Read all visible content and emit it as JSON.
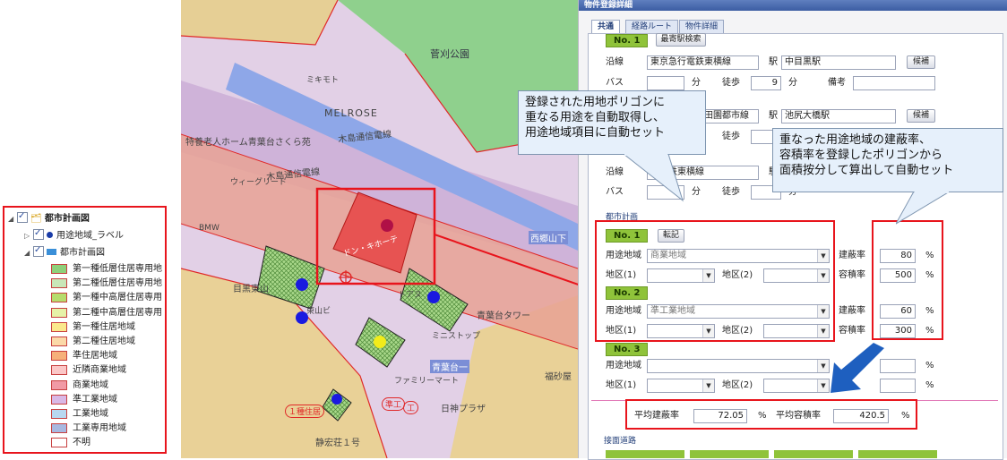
{
  "legend": {
    "root_label": "都市計画図",
    "group_label_layer": "用途地域_ラベル",
    "group_plan": "都市計画図",
    "items": [
      {
        "label": "第一種低層住居専用地",
        "fill": "#8ed07a"
      },
      {
        "label": "第二種低層住居専用地",
        "fill": "#c9e6b8"
      },
      {
        "label": "第一種中高層住居専用",
        "fill": "#b6dc6c"
      },
      {
        "label": "第二種中高層住居専用",
        "fill": "#e6f2a8"
      },
      {
        "label": "第一種住居地域",
        "fill": "#fbe88c"
      },
      {
        "label": "第二種住居地域",
        "fill": "#fbd9a8"
      },
      {
        "label": "準住居地域",
        "fill": "#f6b07a"
      },
      {
        "label": "近隣商業地域",
        "fill": "#fbc7c7"
      },
      {
        "label": "商業地域",
        "fill": "#f19aa5"
      },
      {
        "label": "準工業地域",
        "fill": "#d9b8e6"
      },
      {
        "label": "工業地域",
        "fill": "#b8d8f0"
      },
      {
        "label": "工業専用地域",
        "fill": "#a8b8e0"
      },
      {
        "label": "不明",
        "fill": "#ffffff"
      }
    ]
  },
  "map": {
    "park": "菅刈公園",
    "mikisato": "ミキモト",
    "melrose": "MELROSE",
    "road1": "木島通信電線",
    "road2": "木島通信電線",
    "nursing": "特養老人ホーム青葉台さくら苑",
    "villa": "ウィーグリード",
    "donki": "ドン・キホーテ",
    "station_west": "西郷山下",
    "bmw": "BMW",
    "higashiyama": "目黒東山",
    "higashiyama2": "東山ビ",
    "tora": "トアヌ",
    "ministop": "ミニストップ",
    "aobadai_tower": "青葉台タワー",
    "aobadai": "青葉台一",
    "family": "ファミリーマート",
    "nisshin": "日神プラザ",
    "shigesho": "静宏荘１号",
    "hikawa": "福砂屋",
    "zone_label1": "１種住居",
    "zone_label2": "準工",
    "zone_label3": "工"
  },
  "panel": {
    "title": "物件登録詳細",
    "tabs": [
      "共通",
      "経路ルート",
      "物件詳細"
    ],
    "access_header": "最寄駅検索",
    "no1": "No. 1",
    "no2": "No. 2",
    "no3": "No. 3",
    "line_label": "沿線",
    "station_label": "駅",
    "bus_label": "バス",
    "min_label": "分",
    "walk_label": "徒歩",
    "note_label": "備考",
    "candidate_btn": "候補",
    "lines": [
      {
        "line": "東京急行電鉄東横線",
        "station": "中目黒駅",
        "walk": "9"
      },
      {
        "line": "田園都市線",
        "station": "池尻大橋駅",
        "walk": ""
      },
      {
        "line": "行電鉄東横線",
        "station": "",
        "walk": ""
      }
    ],
    "city_plan_header": "都市計画",
    "transfer_btn": "転記",
    "use_zone_label": "用途地域",
    "district1_label": "地区(1)",
    "district2_label": "地区(2)",
    "bcr_label": "建蔽率",
    "far_label": "容積率",
    "pct": "%",
    "zone1": {
      "use": "商業地域",
      "bcr": "80",
      "far": "500"
    },
    "zone2": {
      "use": "準工業地域",
      "bcr": "60",
      "far": "300"
    },
    "avg_bcr_label": "平均建蔽率",
    "avg_bcr": "72.05",
    "avg_far_label": "平均容積率",
    "avg_far": "420.5",
    "road_header": "接面道路"
  },
  "callouts": {
    "left_lines": [
      "登録された用地ポリゴンに",
      "重なる用途を自動取得し、",
      "用途地域項目に自動セット"
    ],
    "right_lines": [
      "重なった用途地域の建蔽率、",
      "容積率を登録したポリゴンから",
      "面積按分して算出して自動セット"
    ]
  }
}
